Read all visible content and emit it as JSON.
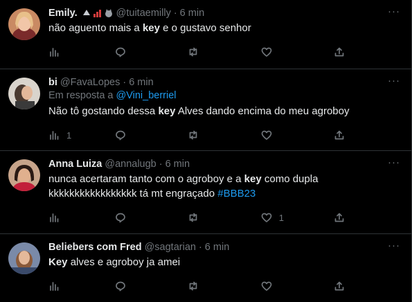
{
  "tweets": [
    {
      "name": "Emily.",
      "handle": "@tuitaemilly",
      "time": "6 min",
      "reply_to": null,
      "text_parts": [
        {
          "t": "não aguento mais a ",
          "b": false
        },
        {
          "t": "key",
          "b": true
        },
        {
          "t": " e o gustavo senhor",
          "b": false
        }
      ],
      "views": "",
      "replies": "",
      "likes": "",
      "avatar_color": "#d9a07a"
    },
    {
      "name": "bi",
      "handle": "@FavaLopes",
      "time": "6 min",
      "reply_prefix": "Em resposta a ",
      "reply_to": "@Vini_berriel",
      "text_parts": [
        {
          "t": "Não tô gostando dessa ",
          "b": false
        },
        {
          "t": "key",
          "b": true
        },
        {
          "t": " Alves dando encima do meu agroboy",
          "b": false
        }
      ],
      "views": "1",
      "replies": "",
      "likes": "",
      "avatar_color": "#6b6b6b"
    },
    {
      "name": "Anna Luiza",
      "handle": "@annalugb",
      "time": "6 min",
      "reply_to": null,
      "text_parts": [
        {
          "t": "nunca acertaram tanto com o agroboy e a ",
          "b": false
        },
        {
          "t": "key",
          "b": true
        },
        {
          "t": " como dupla",
          "b": false
        }
      ],
      "text_line2": "kkkkkkkkkkkkkkkkk tá mt engraçado ",
      "hashtag": "#BBB23",
      "views": "",
      "replies": "",
      "likes": "1",
      "avatar_color": "#8a3a4a"
    },
    {
      "name": "Beliebers com Fred",
      "handle": "@sagtarian",
      "time": "6 min",
      "reply_to": null,
      "text_parts": [
        {
          "t": "Key",
          "b": true
        },
        {
          "t": " alves e agroboy ja amei",
          "b": false
        }
      ],
      "views": "",
      "replies": "",
      "likes": "",
      "avatar_color": "#5b6a8a"
    }
  ],
  "separator": "·",
  "more_label": "···",
  "icons": [
    "views-icon",
    "reply-icon",
    "retweet-icon",
    "like-icon",
    "share-icon"
  ],
  "colors": {
    "background": "#000000",
    "text": "#e7e9ea",
    "muted": "#71767b",
    "link": "#1d9bf0",
    "border": "#2f3336"
  }
}
